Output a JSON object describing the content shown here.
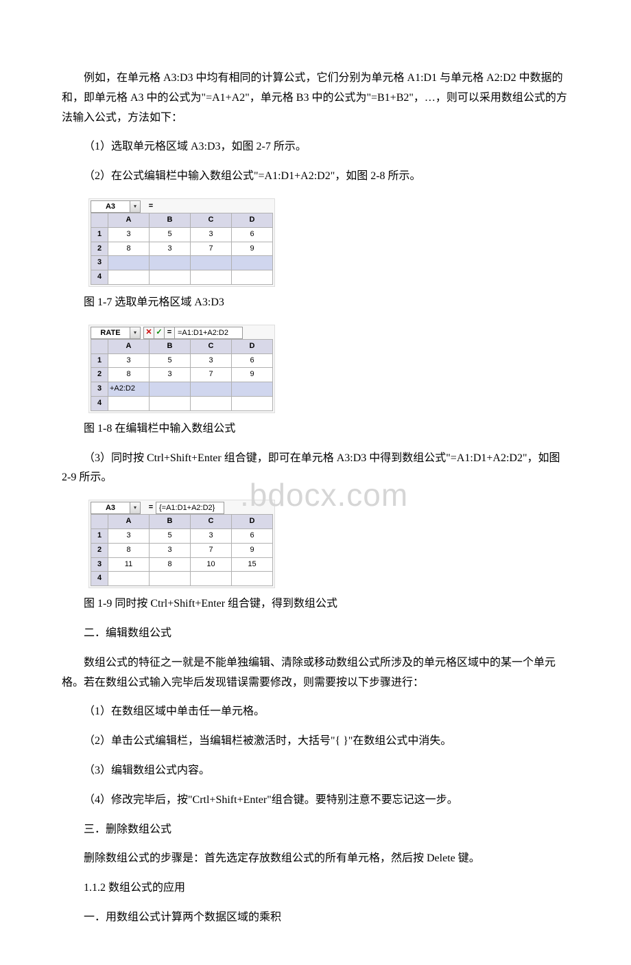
{
  "para1": "例如，在单元格 A3:D3 中均有相同的计算公式，它们分别为单元格 A1:D1 与单元格 A2:D2 中数据的和，即单元格 A3 中的公式为\"=A1+A2\"，单元格 B3 中的公式为\"=B1+B2\"，…，则可以采用数组公式的方法输入公式，方法如下：",
  "step1": "（1）选取单元格区域 A3:D3，如图 2-7 所示。",
  "step2": "（2）在公式编辑栏中输入数组公式\"=A1:D1+A2:D2\"，如图 2-8 所示。",
  "caption1": "图 1-7  选取单元格区域 A3:D3",
  "caption2": "图 1-8  在编辑栏中输入数组公式",
  "step3": "（3）同时按 Ctrl+Shift+Enter 组合键，即可在单元格 A3:D3 中得到数组公式\"=A1:D1+A2:D2\"，如图 2-9 所示。",
  "caption3": "图 1-9  同时按 Ctrl+Shift+Enter 组合键，得到数组公式",
  "sec2title": "二．编辑数组公式",
  "sec2body": "数组公式的特征之一就是不能单独编辑、清除或移动数组公式所涉及的单元格区域中的某一个单元格。若在数组公式输入完毕后发现错误需要修改，则需要按以下步骤进行：",
  "sec2s1": "（1）在数组区域中单击任一单元格。",
  "sec2s2": "（2）单击公式编辑栏，当编辑栏被激活时，大括号\"{ }\"在数组公式中消失。",
  "sec2s3": "（3）编辑数组公式内容。",
  "sec2s4": "（4）修改完毕后，按\"Crtl+Shift+Enter\"组合键。要特别注意不要忘记这一步。",
  "sec3title": "三．删除数组公式",
  "sec3body": "删除数组公式的步骤是：首先选定存放数组公式的所有单元格，然后按 Delete 键。",
  "h112": "1.1.2 数组公式的应用",
  "h112s1": "一．用数组公式计算两个数据区域的乘积",
  "watermark": ".bdocx.com",
  "fig1": {
    "namebox": "A3",
    "headers": [
      "A",
      "B",
      "C",
      "D"
    ],
    "rows": [
      {
        "n": "1",
        "cells": [
          "3",
          "5",
          "3",
          "6"
        ]
      },
      {
        "n": "2",
        "cells": [
          "8",
          "3",
          "7",
          "9"
        ]
      },
      {
        "n": "3",
        "cells": [
          "",
          "",
          "",
          ""
        ],
        "sel": true
      },
      {
        "n": "4",
        "cells": [
          "",
          "",
          "",
          ""
        ]
      }
    ]
  },
  "fig2": {
    "namebox": "RATE",
    "formula": "=A1:D1+A2:D2",
    "headers": [
      "A",
      "B",
      "C",
      "D"
    ],
    "rows": [
      {
        "n": "1",
        "cells": [
          "3",
          "5",
          "3",
          "6"
        ]
      },
      {
        "n": "2",
        "cells": [
          "8",
          "3",
          "7",
          "9"
        ]
      },
      {
        "n": "3",
        "cells": [
          "+A2:D2",
          "",
          "",
          ""
        ],
        "sel": true,
        "leftalign0": true
      },
      {
        "n": "4",
        "cells": [
          "",
          "",
          "",
          ""
        ]
      }
    ]
  },
  "fig3": {
    "namebox": "A3",
    "formula": "{=A1:D1+A2:D2}",
    "headers": [
      "A",
      "B",
      "C",
      "D"
    ],
    "rows": [
      {
        "n": "1",
        "cells": [
          "3",
          "5",
          "3",
          "6"
        ]
      },
      {
        "n": "2",
        "cells": [
          "8",
          "3",
          "7",
          "9"
        ]
      },
      {
        "n": "3",
        "cells": [
          "11",
          "8",
          "10",
          "15"
        ],
        "result": true
      },
      {
        "n": "4",
        "cells": [
          "",
          "",
          "",
          ""
        ]
      }
    ]
  }
}
